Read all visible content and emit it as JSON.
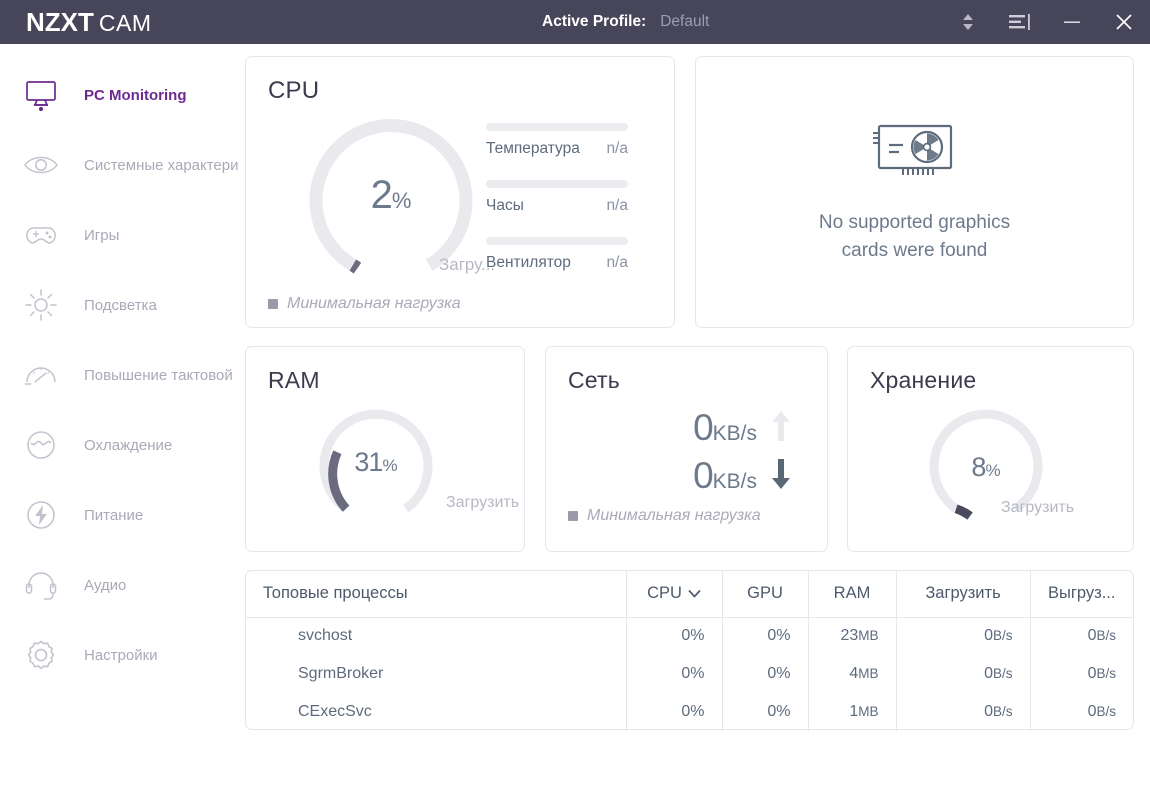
{
  "titlebar": {
    "brand_primary": "NZXT",
    "brand_secondary": "CAM",
    "profile_label": "Active Profile:",
    "profile_value": "Default",
    "icons": [
      "sort-updown-icon",
      "list-menu-icon",
      "minimize-icon",
      "close-icon"
    ]
  },
  "sidebar": {
    "items": [
      {
        "label": "PC Monitoring",
        "icon": "monitor-icon",
        "active": true
      },
      {
        "label": "Системные характери",
        "icon": "eye-icon",
        "active": false
      },
      {
        "label": "Игры",
        "icon": "gamepad-icon",
        "active": false
      },
      {
        "label": "Подсветка",
        "icon": "sun-icon",
        "active": false
      },
      {
        "label": "Повышение тактовой",
        "icon": "gauge-icon",
        "active": false
      },
      {
        "label": "Охлаждение",
        "icon": "cooling-icon",
        "active": false
      },
      {
        "label": "Питание",
        "icon": "power-bolt-icon",
        "active": false
      },
      {
        "label": "Аудио",
        "icon": "headset-icon",
        "active": false
      },
      {
        "label": "Настройки",
        "icon": "gear-icon",
        "active": false
      }
    ]
  },
  "cpu": {
    "title": "CPU",
    "percent_number": "2",
    "percent_symbol": "%",
    "percent_value": 2,
    "gauge_label": "Загру...",
    "footer_text": "Минимальная нагрузка",
    "stats": [
      {
        "label": "Температура",
        "value": "n/a",
        "bar_percent": 0
      },
      {
        "label": "Часы",
        "value": "n/a",
        "bar_percent": 0
      },
      {
        "label": "Вентилятор",
        "value": "n/a",
        "bar_percent": 0
      }
    ]
  },
  "gpu": {
    "icon": "graphics-card-icon",
    "message": "No supported graphics cards were found"
  },
  "ram": {
    "title": "RAM",
    "percent_number": "31",
    "percent_symbol": "%",
    "percent_value": 31,
    "gauge_label": "Загрузить"
  },
  "network": {
    "title": "Сеть",
    "upload_value": "0",
    "upload_unit": "KB/s",
    "download_value": "0",
    "download_unit": "KB/s",
    "footer_text": "Минимальная нагрузка"
  },
  "storage": {
    "title": "Хранение",
    "percent_number": "8",
    "percent_symbol": "%",
    "percent_value": 8,
    "gauge_label": "Загрузить"
  },
  "processes": {
    "columns": [
      "Топовые процессы",
      "CPU",
      "GPU",
      "RAM",
      "Загрузить",
      "Выгруз..."
    ],
    "sorted_column": "CPU",
    "rows": [
      {
        "name": "svchost",
        "cpu": "0%",
        "gpu": "0%",
        "ram": "23",
        "ram_unit": "MB",
        "down": "0",
        "down_unit": "B/s",
        "up": "0",
        "up_unit": "B/s"
      },
      {
        "name": "SgrmBroker",
        "cpu": "0%",
        "gpu": "0%",
        "ram": "4",
        "ram_unit": "MB",
        "down": "0",
        "down_unit": "B/s",
        "up": "0",
        "up_unit": "B/s"
      },
      {
        "name": "CExecSvc",
        "cpu": "0%",
        "gpu": "0%",
        "ram": "1",
        "ram_unit": "MB",
        "down": "0",
        "down_unit": "B/s",
        "up": "0",
        "up_unit": "B/s"
      }
    ]
  },
  "colors": {
    "titlebar_bg": "#474559",
    "accent_purple": "#6c2a91",
    "gauge_track": "#e9e9ee",
    "gauge_fill": "#6b6b7f",
    "text_slate": "#5d6b7d",
    "muted": "#a9a9b8"
  }
}
